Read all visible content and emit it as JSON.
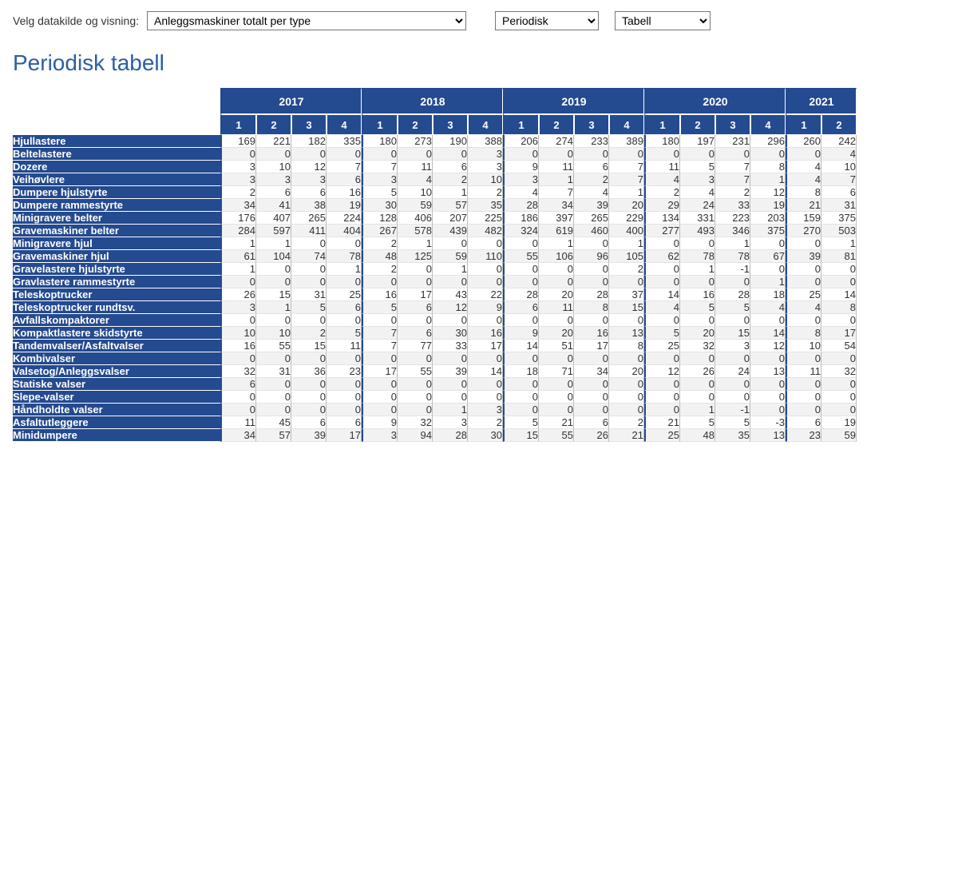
{
  "controls": {
    "label": "Velg datakilde og visning:",
    "source_selected": "Anleggsmaskiner totalt per type",
    "period_selected": "Periodisk",
    "view_selected": "Tabell"
  },
  "title": "Periodisk tabell",
  "chart_data": {
    "type": "table",
    "years": [
      {
        "year": "2017",
        "quarters": [
          "1",
          "2",
          "3",
          "4"
        ]
      },
      {
        "year": "2018",
        "quarters": [
          "1",
          "2",
          "3",
          "4"
        ]
      },
      {
        "year": "2019",
        "quarters": [
          "1",
          "2",
          "3",
          "4"
        ]
      },
      {
        "year": "2020",
        "quarters": [
          "1",
          "2",
          "3",
          "4"
        ]
      },
      {
        "year": "2021",
        "quarters": [
          "1",
          "2"
        ]
      }
    ],
    "rows": [
      {
        "label": "Hjullastere",
        "values": [
          169,
          221,
          182,
          335,
          180,
          273,
          190,
          388,
          206,
          274,
          233,
          389,
          180,
          197,
          231,
          296,
          260,
          242
        ]
      },
      {
        "label": "Beltelastere",
        "values": [
          0,
          0,
          0,
          0,
          0,
          0,
          0,
          3,
          0,
          0,
          0,
          0,
          0,
          0,
          0,
          0,
          0,
          4
        ]
      },
      {
        "label": "Dozere",
        "values": [
          3,
          10,
          12,
          7,
          7,
          11,
          6,
          3,
          9,
          11,
          6,
          7,
          11,
          5,
          7,
          8,
          4,
          10
        ]
      },
      {
        "label": "Veihøvlere",
        "values": [
          3,
          3,
          3,
          6,
          3,
          4,
          2,
          10,
          3,
          1,
          2,
          7,
          4,
          3,
          7,
          1,
          4,
          7
        ]
      },
      {
        "label": "Dumpere hjulstyrte",
        "values": [
          2,
          6,
          6,
          16,
          5,
          10,
          1,
          2,
          4,
          7,
          4,
          1,
          2,
          4,
          2,
          12,
          8,
          6
        ]
      },
      {
        "label": "Dumpere rammestyrte",
        "values": [
          34,
          41,
          38,
          19,
          30,
          59,
          57,
          35,
          28,
          34,
          39,
          20,
          29,
          24,
          33,
          19,
          21,
          31
        ]
      },
      {
        "label": "Minigravere belter",
        "values": [
          176,
          407,
          265,
          224,
          128,
          406,
          207,
          225,
          186,
          397,
          265,
          229,
          134,
          331,
          223,
          203,
          159,
          375
        ]
      },
      {
        "label": "Gravemaskiner belter",
        "values": [
          284,
          597,
          411,
          404,
          267,
          578,
          439,
          482,
          324,
          619,
          460,
          400,
          277,
          493,
          346,
          375,
          270,
          503
        ]
      },
      {
        "label": "Minigravere hjul",
        "values": [
          1,
          1,
          0,
          0,
          2,
          1,
          0,
          0,
          0,
          1,
          0,
          1,
          0,
          0,
          1,
          0,
          0,
          1
        ]
      },
      {
        "label": "Gravemaskiner hjul",
        "values": [
          61,
          104,
          74,
          78,
          48,
          125,
          59,
          110,
          55,
          106,
          96,
          105,
          62,
          78,
          78,
          67,
          39,
          81
        ]
      },
      {
        "label": "Gravelastere hjulstyrte",
        "values": [
          1,
          0,
          0,
          1,
          2,
          0,
          1,
          0,
          0,
          0,
          0,
          2,
          0,
          1,
          -1,
          0,
          0,
          0
        ]
      },
      {
        "label": "Gravlastere rammestyrte",
        "values": [
          0,
          0,
          0,
          0,
          0,
          0,
          0,
          0,
          0,
          0,
          0,
          0,
          0,
          0,
          0,
          1,
          0,
          0
        ]
      },
      {
        "label": "Teleskoptrucker",
        "values": [
          26,
          15,
          31,
          25,
          16,
          17,
          43,
          22,
          28,
          20,
          28,
          37,
          14,
          16,
          28,
          18,
          25,
          14
        ]
      },
      {
        "label": "Teleskoptrucker rundtsv.",
        "values": [
          3,
          1,
          5,
          6,
          5,
          6,
          12,
          9,
          6,
          11,
          8,
          15,
          4,
          5,
          5,
          4,
          4,
          8
        ]
      },
      {
        "label": "Avfallskompaktorer",
        "values": [
          0,
          0,
          0,
          0,
          0,
          0,
          0,
          0,
          0,
          0,
          0,
          0,
          0,
          0,
          0,
          0,
          0,
          0
        ]
      },
      {
        "label": "Kompaktlastere skidstyrte",
        "values": [
          10,
          10,
          2,
          5,
          7,
          6,
          30,
          16,
          9,
          20,
          16,
          13,
          5,
          20,
          15,
          14,
          8,
          17
        ]
      },
      {
        "label": "Tandemvalser/Asfaltvalser",
        "values": [
          16,
          55,
          15,
          11,
          7,
          77,
          33,
          17,
          14,
          51,
          17,
          8,
          25,
          32,
          3,
          12,
          10,
          54
        ]
      },
      {
        "label": "Kombivalser",
        "values": [
          0,
          0,
          0,
          0,
          0,
          0,
          0,
          0,
          0,
          0,
          0,
          0,
          0,
          0,
          0,
          0,
          0,
          0
        ]
      },
      {
        "label": "Valsetog/Anleggsvalser",
        "values": [
          32,
          31,
          36,
          23,
          17,
          55,
          39,
          14,
          18,
          71,
          34,
          20,
          12,
          26,
          24,
          13,
          11,
          32
        ]
      },
      {
        "label": "Statiske valser",
        "values": [
          6,
          0,
          0,
          0,
          0,
          0,
          0,
          0,
          0,
          0,
          0,
          0,
          0,
          0,
          0,
          0,
          0,
          0
        ]
      },
      {
        "label": "Slepe-valser",
        "values": [
          0,
          0,
          0,
          0,
          0,
          0,
          0,
          0,
          0,
          0,
          0,
          0,
          0,
          0,
          0,
          0,
          0,
          0
        ]
      },
      {
        "label": "Håndholdte valser",
        "values": [
          0,
          0,
          0,
          0,
          0,
          0,
          1,
          3,
          0,
          0,
          0,
          0,
          0,
          1,
          -1,
          0,
          0,
          0
        ]
      },
      {
        "label": "Asfaltutleggere",
        "values": [
          11,
          45,
          6,
          6,
          9,
          32,
          3,
          2,
          5,
          21,
          6,
          2,
          21,
          5,
          5,
          -3,
          6,
          19
        ]
      },
      {
        "label": "Minidumpere",
        "values": [
          34,
          57,
          39,
          17,
          3,
          94,
          28,
          30,
          15,
          55,
          26,
          21,
          25,
          48,
          35,
          13,
          23,
          59
        ]
      }
    ]
  }
}
